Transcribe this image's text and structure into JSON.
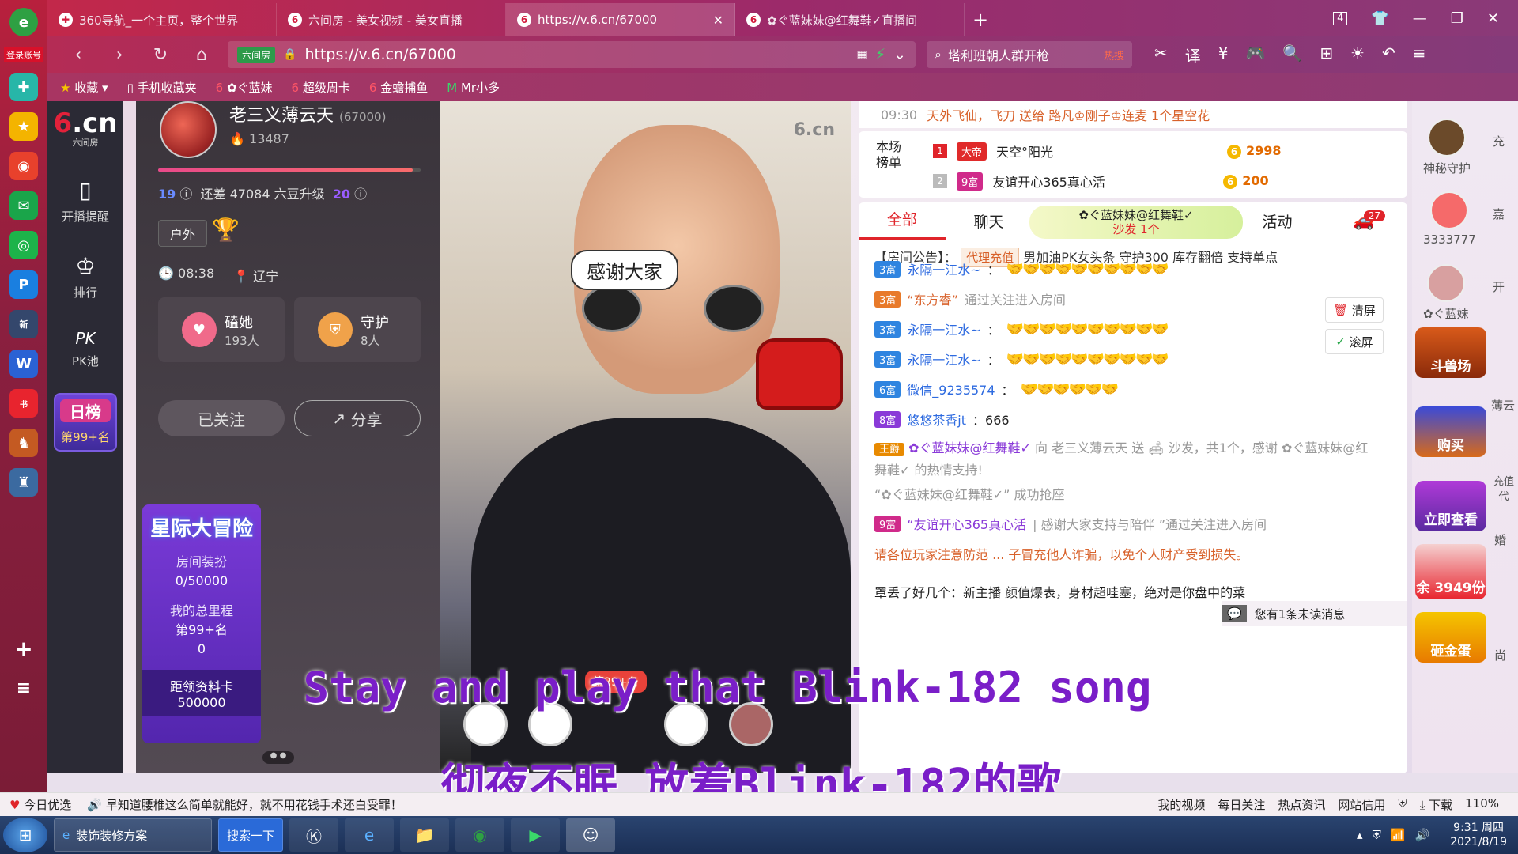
{
  "browser": {
    "login_label": "登录账号",
    "tabs": [
      {
        "label": "360导航_一个主页，整个世界",
        "icon": "360-icon"
      },
      {
        "label": "六间房 - 美女视频 - 美女直播",
        "icon": "6cn-icon"
      },
      {
        "label": "https://v.6.cn/67000",
        "icon": "6cn-icon"
      },
      {
        "label": "✿ぐ蓝妹妹@红舞鞋✓直播间",
        "icon": "6cn-icon"
      }
    ],
    "tab_count": "4",
    "url": "https://v.6.cn/67000",
    "url_badge": "六间房",
    "search_text": "塔利班朝人群开枪",
    "search_hot": "热搜",
    "bookmarks": [
      "收藏",
      "手机收藏夹",
      "✿ぐ蓝妹",
      "超级周卡",
      "金蟾捕鱼",
      "Mr小多"
    ]
  },
  "site": {
    "logo": "6.cn",
    "logo_sub": "六间房",
    "nav": [
      {
        "label": "开播提醒",
        "icon": "phone-icon"
      },
      {
        "label": "排行",
        "icon": "crown-icon"
      },
      {
        "label": "PK池",
        "icon": "pk-icon"
      }
    ],
    "daily_rank": {
      "title": "日榜",
      "rank": "第99+名"
    }
  },
  "anchor": {
    "name": "老三义薄云天",
    "room_id": "(67000)",
    "fans": "13487",
    "level_from": "19",
    "level_to": "20",
    "level_text": "还差 47084 六豆升级",
    "level_progress": 0.97,
    "tag": "户外",
    "time": "08:38",
    "location": "辽宁",
    "fans_group": {
      "label": "磕她",
      "count": "193人"
    },
    "guard": {
      "label": "守护",
      "count": "8人"
    },
    "follow_label": "已关注",
    "share_label": "分享"
  },
  "adventure": {
    "title": "星际大冒险",
    "decor_label": "房间装扮",
    "decor_value": "0/50000",
    "mileage_label": "我的总里程",
    "mileage_rank": "第99+名",
    "mileage_value": "0",
    "card_label": "距领资料卡",
    "card_value": "500000"
  },
  "video": {
    "bubble": "感谢大家",
    "watermark": "6.cn",
    "rank_badge": "第29+名"
  },
  "ranking": {
    "label": "本场榜单",
    "top_time": "09:30",
    "top_msg": "天外飞仙，飞刀 送给 路凡♔刚子♔连麦 1个星空花",
    "rows": [
      {
        "num": "1",
        "level": "大帝",
        "name": "天空°阳光",
        "coins": "2998"
      },
      {
        "num": "2",
        "level": "9富",
        "name": "友谊开心365真心活",
        "coins": "200"
      }
    ]
  },
  "chat": {
    "tabs": [
      "全部",
      "聊天",
      "活动"
    ],
    "sofa_user": "✿ぐ蓝妹妹@红舞鞋✓",
    "sofa_text": "沙发 1个",
    "car_count": "27",
    "notice_label": "【房间公告】：",
    "notice_agent": "代理充值",
    "notice_text": "男加油PK女头条 守护300 库存翻倍 支持单点",
    "clear_label": "清屏",
    "scroll_label": "滚屏",
    "messages": [
      {
        "level": "3富",
        "name": "永隔一江水~",
        "text": "：",
        "hands": "🤝🤝🤝🤝🤝🤝🤝🤝🤝🤝"
      },
      {
        "level": "3富",
        "name": "“东方睿”",
        "text": "通过关注进入房间"
      },
      {
        "level": "3富",
        "name": "永隔一江水~",
        "text": "：",
        "hands": "🤝🤝🤝🤝🤝🤝🤝🤝🤝🤝"
      },
      {
        "level": "3富",
        "name": "永隔一江水~",
        "text": "：",
        "hands": "🤝🤝🤝🤝🤝🤝🤝🤝🤝🤝"
      },
      {
        "level": "6富",
        "name": "微信_9235574",
        "text": "：",
        "hands": "🤝🤝🤝🤝🤝🤝"
      },
      {
        "level": "8富",
        "name": "悠悠茶香jt",
        "text": "：666"
      },
      {
        "level": "王爵",
        "name": "✿ぐ蓝妹妹@红舞鞋✓",
        "text": "向 老三义薄云天 送 🛋 沙发，共1个，感谢 ✿ぐ蓝妹妹@红舞鞋✓ 的热情支持!"
      },
      {
        "level": "",
        "name": "",
        "text": "“✿ぐ蓝妹妹@红舞鞋✓” 成功抢座"
      },
      {
        "level": "9富",
        "name": "“友谊开心365真心活",
        "text": "| 感谢大家支持与陪伴 ”通过关注进入房间"
      },
      {
        "level": "",
        "name": "",
        "text": "请各位玩家注意防范 ... 子冒充他人诈骗，以免个人财产受到损失。"
      },
      {
        "level": "",
        "name": "",
        "text": "罩丢了好几个：新主播 颜值爆表，身材超哇塞，绝对是你盘中的菜"
      }
    ],
    "unread_msg": "您有1条未读消息"
  },
  "right": {
    "items": [
      {
        "label": "神秘守护"
      },
      {
        "label": "3333777"
      },
      {
        "label": "✿ぐ蓝妹"
      }
    ],
    "extra": [
      "充",
      "嘉",
      "开"
    ],
    "promos": [
      {
        "label": "斗兽场"
      },
      {
        "label": "购买"
      },
      {
        "label": "立即查看"
      },
      {
        "label": "余 3949份"
      },
      {
        "label": "砸金蛋"
      }
    ],
    "side_text": [
      "薄云",
      "充值代",
      "婚",
      "尚"
    ]
  },
  "subtitles": {
    "en": "Stay and play that Blink-182 song",
    "zh": "彻夜不眠 放着Blink-182的歌"
  },
  "statusbar": {
    "left": [
      "今日优选",
      "早知道腰椎这么简单就能好，就不用花钱手术还白受罪！"
    ],
    "right": [
      "我的视频",
      "每日关注",
      "热点资讯",
      "网站信用",
      "下载",
      "110%"
    ]
  },
  "taskbar": {
    "ie_item": "装饰装修方案",
    "search_btn": "搜索一下",
    "time": "9:31 周四",
    "date": "2021/8/19"
  }
}
